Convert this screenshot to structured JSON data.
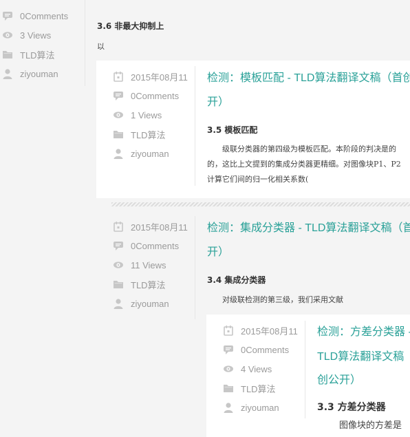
{
  "colors": {
    "title": "#2aa198",
    "meta": "#9a9a9a",
    "icon": "#c7c7c7"
  },
  "top_partial": {
    "meta": {
      "comments": "0Comments",
      "views": "3 Views",
      "category": "TLD算法",
      "author": "ziyouman"
    },
    "section_heading": "3.6 非最大抑制上",
    "paragraph": "以"
  },
  "posts": [
    {
      "date": "2015年08月11",
      "comments": "0Comments",
      "views": "1 Views",
      "category": "TLD算法",
      "author": "ziyouman",
      "title_line1": "检测：模板匹配 - TLD算法翻译文稿（首创",
      "title_line2": "开）",
      "section_heading": "3.5 模板匹配",
      "paragraph_lines": [
        "　　级联分类器的第四级为模板匹配。本阶段的判决是的",
        "的，这比上文提到的集成分类器更精细。对图像块P1、P2",
        "计算它们间的归一化相关系数("
      ]
    },
    {
      "date": "2015年08月11",
      "comments": "0Comments",
      "views": "11 Views",
      "category": "TLD算法",
      "author": "ziyouman",
      "title_line1": "检测：集成分类器 - TLD算法翻译文稿（首",
      "title_line2": "开）",
      "section_heading": "3.4 集成分类器",
      "paragraph_lines": [
        "　　对级联检测的第三级，我们采用文献"
      ]
    },
    {
      "date": "2015年08月11",
      "comments": "0Comments",
      "views": "4 Views",
      "category": "TLD算法",
      "author": "ziyouman",
      "title_line1": "检测：方差分类器 -",
      "title_line2": "TLD算法翻译文稿（",
      "title_line3": "创公开）",
      "section_heading": "3.3 方差分类器",
      "paragraph_lines": [
        "图像块的方差是"
      ]
    }
  ],
  "icons": {
    "date": "calendar-icon",
    "comments": "comment-bubble-icon",
    "views": "eye-icon",
    "category": "folder-icon",
    "author": "user-icon"
  }
}
